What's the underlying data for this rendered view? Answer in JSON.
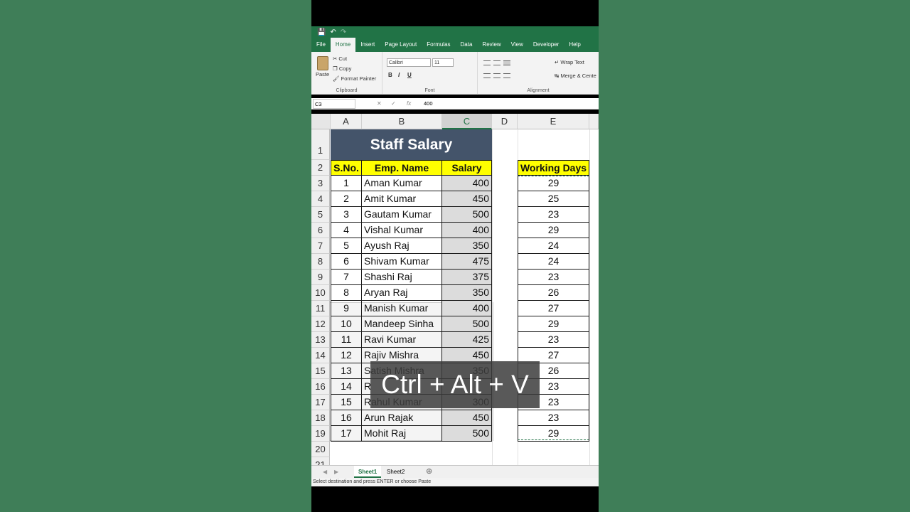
{
  "qat": {
    "save_icon": "save-icon",
    "undo_icon": "undo-icon",
    "redo_icon": "redo-icon"
  },
  "tabs": [
    "File",
    "Home",
    "Insert",
    "Page Layout",
    "Formulas",
    "Data",
    "Review",
    "View",
    "Developer",
    "Help"
  ],
  "active_tab": "Home",
  "ribbon": {
    "paste": "Paste",
    "cut": "Cut",
    "copy": "Copy",
    "format_painter": "Format Painter",
    "clipboard": "Clipboard",
    "font_name": "Calibri",
    "font_size": "11",
    "bold": "B",
    "italic": "I",
    "underline": "U",
    "font": "Font",
    "wrap_text": "Wrap Text",
    "merge_center": "Merge & Cente",
    "alignment": "Alignment"
  },
  "formula_bar": {
    "name_box": "C3",
    "fx": "fx",
    "value": "400"
  },
  "columns": [
    "A",
    "B",
    "C",
    "D",
    "E"
  ],
  "selected_column": "C",
  "title": "Staff Salary",
  "headers": {
    "sno": "S.No.",
    "name": "Emp. Name",
    "salary": "Salary",
    "working_days": "Working Days"
  },
  "rows": [
    {
      "sno": "1",
      "name": "Aman Kumar",
      "salary": "400",
      "days": "29"
    },
    {
      "sno": "2",
      "name": "Amit Kumar",
      "salary": "450",
      "days": "25"
    },
    {
      "sno": "3",
      "name": "Gautam Kumar",
      "salary": "500",
      "days": "23"
    },
    {
      "sno": "4",
      "name": "Vishal Kumar",
      "salary": "400",
      "days": "29"
    },
    {
      "sno": "5",
      "name": "Ayush Raj",
      "salary": "350",
      "days": "24"
    },
    {
      "sno": "6",
      "name": "Shivam Kumar",
      "salary": "475",
      "days": "24"
    },
    {
      "sno": "7",
      "name": "Shashi Raj",
      "salary": "375",
      "days": "23"
    },
    {
      "sno": "8",
      "name": "Aryan Raj",
      "salary": "350",
      "days": "26"
    },
    {
      "sno": "9",
      "name": "Manish Kumar",
      "salary": "400",
      "days": "27"
    },
    {
      "sno": "10",
      "name": "Mandeep Sinha",
      "salary": "500",
      "days": "29"
    },
    {
      "sno": "11",
      "name": "Ravi Kumar",
      "salary": "425",
      "days": "23"
    },
    {
      "sno": "12",
      "name": "Rajiv Mishra",
      "salary": "450",
      "days": "27"
    },
    {
      "sno": "13",
      "name": "Satish Mishra",
      "salary": "350",
      "days": "26"
    },
    {
      "sno": "14",
      "name": "R",
      "salary": "",
      "days": "23"
    },
    {
      "sno": "15",
      "name": "Rahul Kumar",
      "salary": "300",
      "days": "23"
    },
    {
      "sno": "16",
      "name": "Arun Rajak",
      "salary": "450",
      "days": "23"
    },
    {
      "sno": "17",
      "name": "Mohit Raj",
      "salary": "500",
      "days": "29"
    }
  ],
  "row_numbers": [
    "1",
    "2",
    "3",
    "4",
    "5",
    "6",
    "7",
    "8",
    "9",
    "10",
    "11",
    "12",
    "13",
    "14",
    "15",
    "16",
    "17",
    "18",
    "19",
    "20",
    "21"
  ],
  "caption": "Ctrl + Alt + V",
  "sheet_tabs": [
    "Sheet1",
    "Sheet2"
  ],
  "active_sheet": "Sheet1",
  "status": "Select destination and press ENTER or choose Paste",
  "colors": {
    "excel_green": "#217346",
    "header_yellow": "#ffff00",
    "title_fill": "#44546a"
  }
}
